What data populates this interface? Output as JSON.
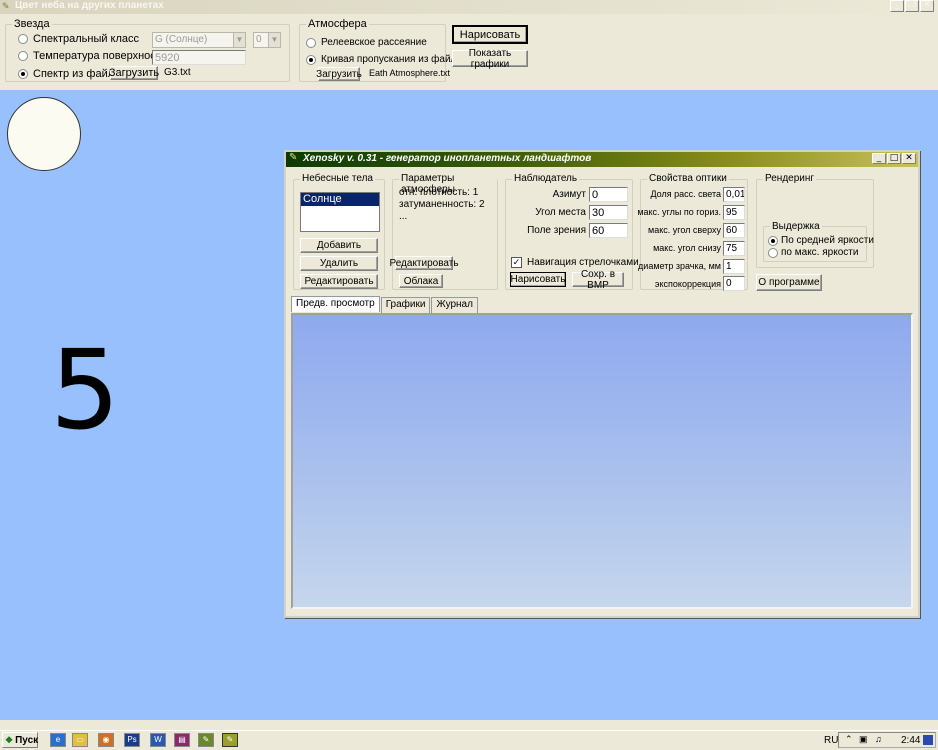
{
  "window": {
    "title": "Цвет неба на других планетах"
  },
  "star_group": {
    "legend": "Звезда",
    "radio_spectral": "Спектральный класс",
    "radio_temperature": "Температура поверхности",
    "radio_file": "Спектр из файла",
    "spectral_class_value": "G (Солнце)",
    "spectral_subclass_value": "0",
    "temperature_value": "5920",
    "load_button": "Загрузить",
    "file_name": "G3.txt"
  },
  "atmosphere_group": {
    "legend": "Атмосфера",
    "radio_rayleigh": "Релеевское рассеяние",
    "radio_curve": "Кривая пропускания из файла",
    "load_button": "Загрузить",
    "file_name": "Eath Atmosphere.txt"
  },
  "actions": {
    "draw_button": "Нарисовать",
    "show_graphs_button": "Показать графики"
  },
  "countdown": "5",
  "inner_window": {
    "title": "Xenosky v. 0.31 - генератор инопланетных ландшафтов",
    "bodies": {
      "legend": "Небесные тела",
      "items": [
        "Солнце"
      ],
      "add_button": "Добавить",
      "delete_button": "Удалить",
      "edit_button": "Редактировать"
    },
    "atmo_params": {
      "legend": "Параметры атмосферы",
      "lines": [
        "отн. плотность: 1",
        "затуманенность: 2",
        "..."
      ],
      "edit_button": "Редактировать",
      "clouds_button": "Облака"
    },
    "observer": {
      "legend": "Наблюдатель",
      "azimuth_label": "Азимут",
      "azimuth_value": "0",
      "altitude_label": "Угол места",
      "altitude_value": "30",
      "fov_label": "Поле зрения",
      "fov_value": "60",
      "arrow_nav_label": "Навигация стрелочками",
      "draw_button": "Нарисовать",
      "save_bmp_button": "Сохр. в BMP"
    },
    "optics": {
      "legend": "Свойства оптики",
      "rows": [
        {
          "label": "Доля расс. света",
          "value": "0,01"
        },
        {
          "label": "макс. углы по гориз.",
          "value": "95"
        },
        {
          "label": "макс. угол сверху",
          "value": "60"
        },
        {
          "label": "макс. угол снизу",
          "value": "75"
        },
        {
          "label": "диаметр зрачка, мм",
          "value": "1"
        },
        {
          "label": "экспокоррекция",
          "value": "0"
        }
      ]
    },
    "rendering": {
      "legend": "Рендеринг",
      "exposure_legend": "Выдержка",
      "radio_mean": "По средней яркости",
      "radio_max": "по макс. яркости",
      "about_button": "О программе"
    },
    "tabs": [
      "Предв. просмотр",
      "Графики",
      "Журнал"
    ]
  },
  "taskbar": {
    "start_label": "Пуск",
    "language": "RU",
    "time": "2:44"
  }
}
